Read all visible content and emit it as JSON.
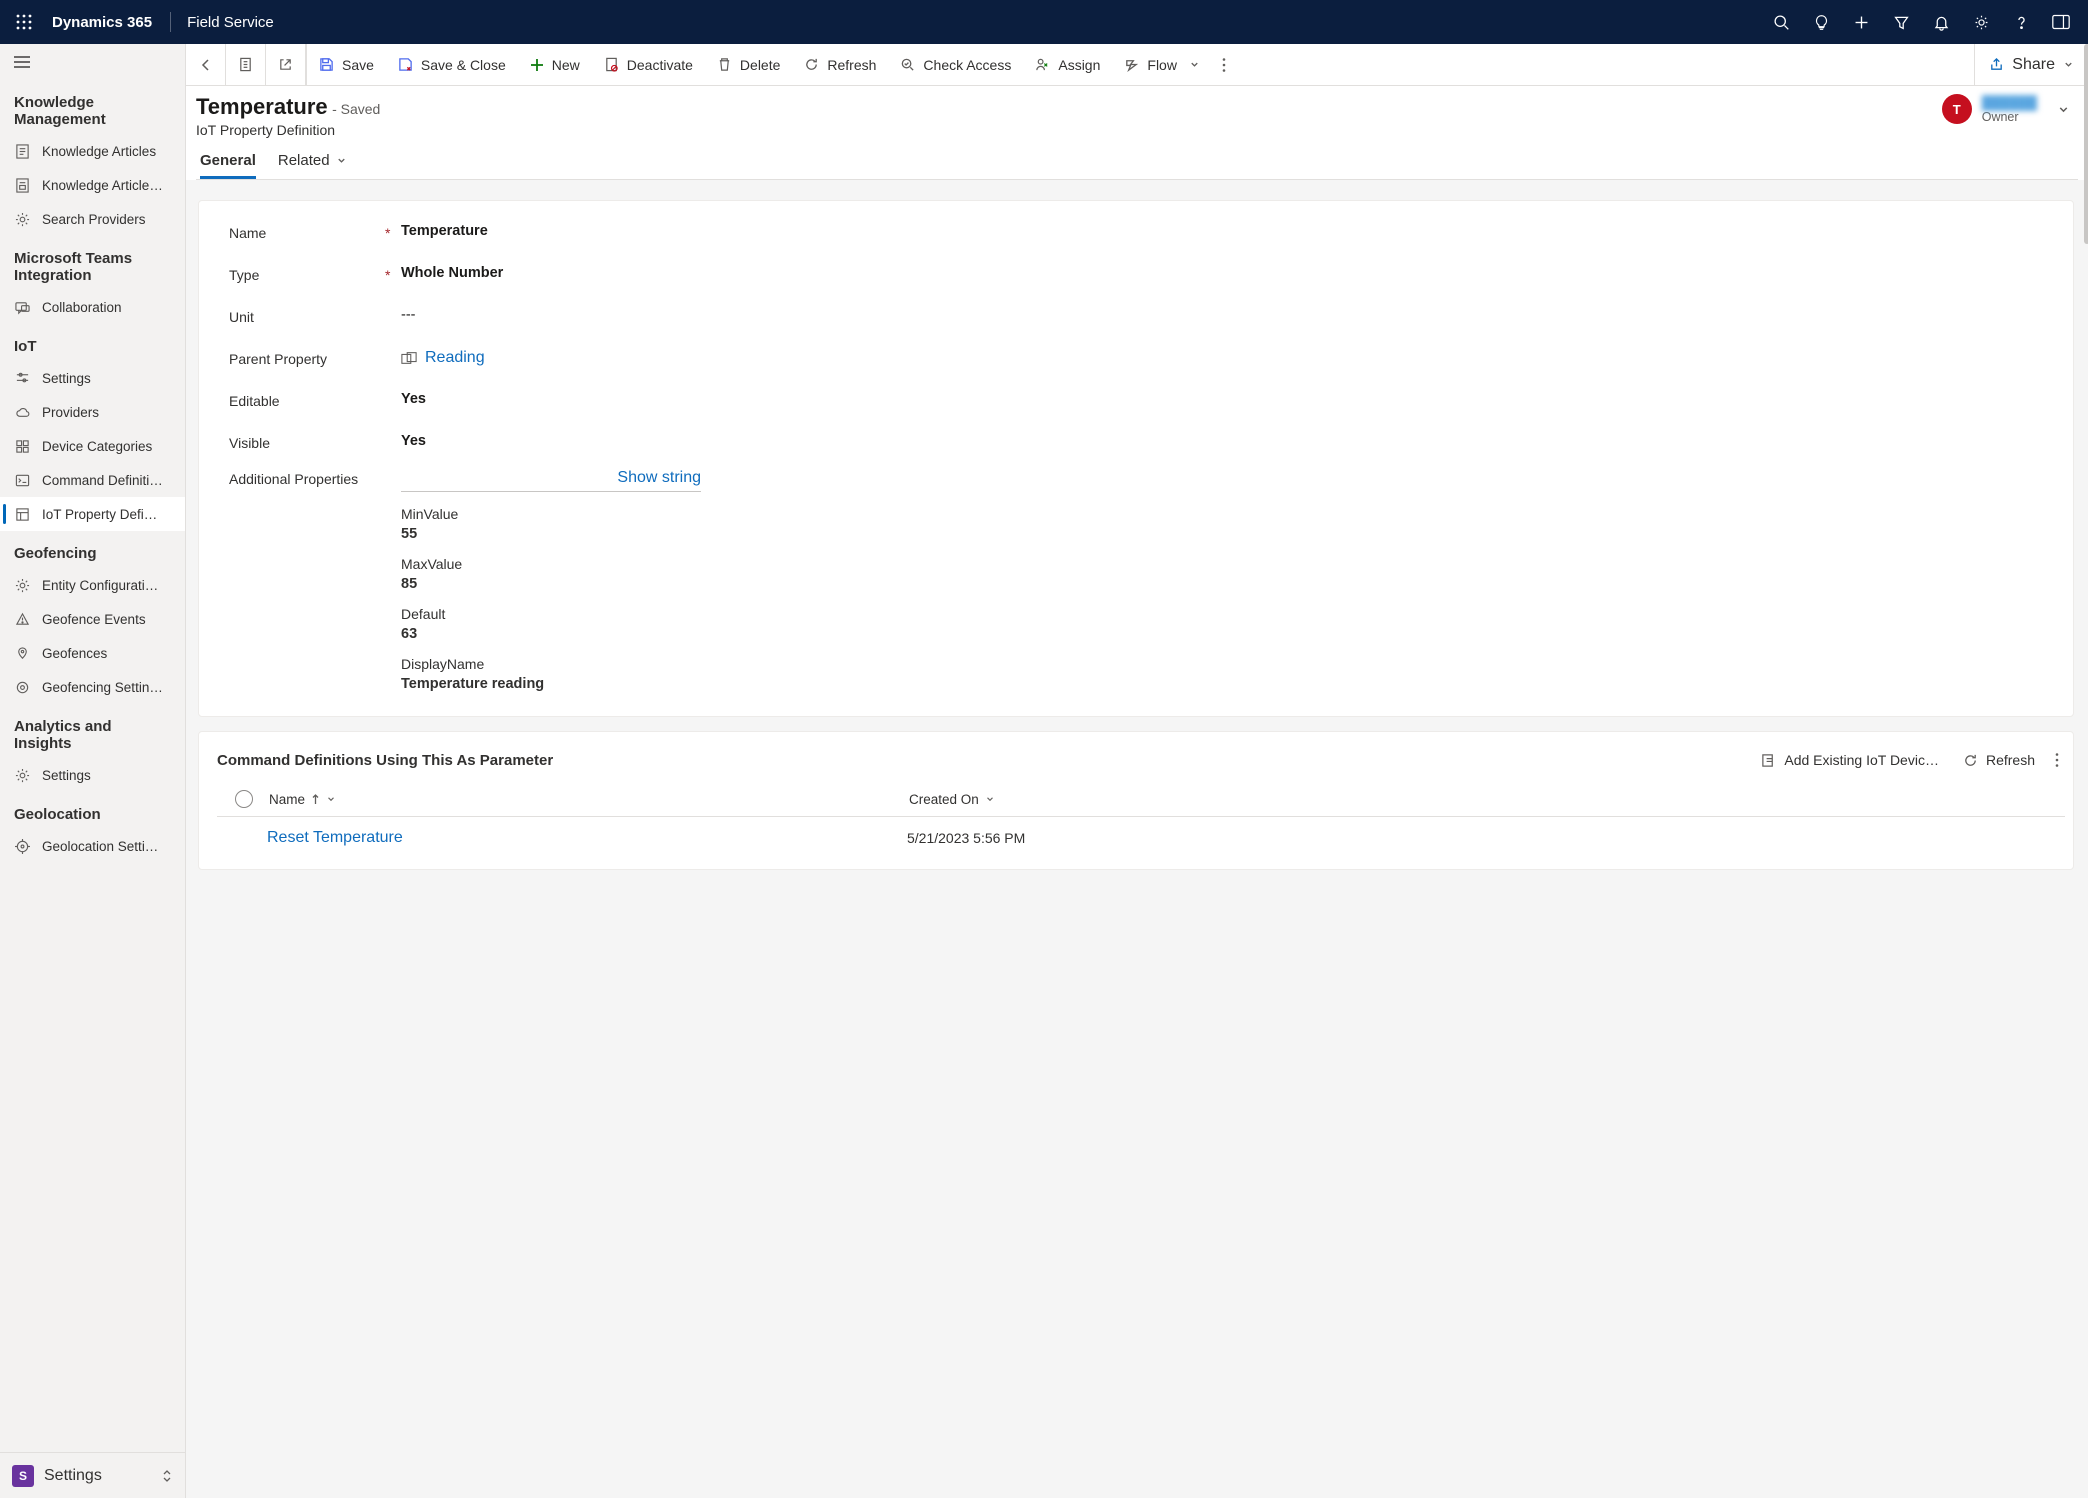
{
  "topbar": {
    "brand": "Dynamics 365",
    "app_name": "Field Service"
  },
  "sidebar": {
    "groups": [
      {
        "title": "Knowledge Management",
        "items": [
          {
            "id": "knowledge-articles",
            "label": "Knowledge Articles"
          },
          {
            "id": "knowledge-article-tmpl",
            "label": "Knowledge Article…"
          },
          {
            "id": "search-providers",
            "label": "Search Providers"
          }
        ]
      },
      {
        "title": "Microsoft Teams Integration",
        "items": [
          {
            "id": "collaboration",
            "label": "Collaboration"
          }
        ]
      },
      {
        "title": "IoT",
        "items": [
          {
            "id": "iot-settings",
            "label": "Settings"
          },
          {
            "id": "iot-providers",
            "label": "Providers"
          },
          {
            "id": "iot-device-categories",
            "label": "Device Categories"
          },
          {
            "id": "iot-command-defs",
            "label": "Command Definiti…"
          },
          {
            "id": "iot-property-defs",
            "label": "IoT Property Defi…",
            "active": true
          }
        ]
      },
      {
        "title": "Geofencing",
        "items": [
          {
            "id": "geo-entity-config",
            "label": "Entity Configurati…"
          },
          {
            "id": "geo-fence-events",
            "label": "Geofence Events"
          },
          {
            "id": "geo-fences",
            "label": "Geofences"
          },
          {
            "id": "geo-fence-settings",
            "label": "Geofencing Settin…"
          }
        ]
      },
      {
        "title": "Analytics and Insights",
        "items": [
          {
            "id": "analytics-settings",
            "label": "Settings"
          }
        ]
      },
      {
        "title": "Geolocation",
        "items": [
          {
            "id": "geoloc-settings",
            "label": "Geolocation Setti…"
          }
        ]
      }
    ],
    "footer": {
      "badge": "S",
      "label": "Settings"
    }
  },
  "commandbar": {
    "save": "Save",
    "save_close": "Save & Close",
    "new": "New",
    "deactivate": "Deactivate",
    "delete": "Delete",
    "refresh": "Refresh",
    "check_access": "Check Access",
    "assign": "Assign",
    "flow": "Flow",
    "share": "Share"
  },
  "record": {
    "title": "Temperature",
    "status": "- Saved",
    "entity": "IoT Property Definition",
    "owner_initial": "T",
    "owner_name": "██████",
    "owner_label": "Owner",
    "tabs": {
      "general": "General",
      "related": "Related"
    },
    "form": {
      "name_label": "Name",
      "name_value": "Temperature",
      "type_label": "Type",
      "type_value": "Whole Number",
      "unit_label": "Unit",
      "unit_value": "---",
      "parent_label": "Parent Property",
      "parent_value": "Reading",
      "editable_label": "Editable",
      "editable_value": "Yes",
      "visible_label": "Visible",
      "visible_value": "Yes",
      "addl_label": "Additional Properties",
      "addl_toggle": "Show string",
      "additional": {
        "min_label": "MinValue",
        "min_value": "55",
        "max_label": "MaxValue",
        "max_value": "85",
        "default_label": "Default",
        "default_value": "63",
        "display_label": "DisplayName",
        "display_value": "Temperature reading"
      }
    }
  },
  "subgrid": {
    "title": "Command Definitions Using This As Parameter",
    "add_existing": "Add Existing IoT Devic…",
    "refresh": "Refresh",
    "col_name": "Name",
    "col_created": "Created On",
    "rows": [
      {
        "name": "Reset Temperature",
        "created": "5/21/2023 5:56 PM"
      }
    ]
  }
}
